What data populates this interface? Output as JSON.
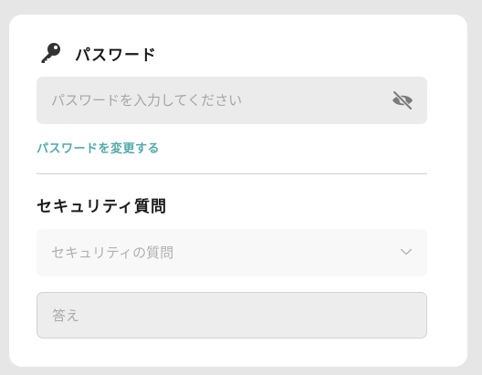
{
  "password_section": {
    "icon": "key-icon",
    "title": "パスワード",
    "input_placeholder": "パスワードを入力してください",
    "input_value": "",
    "visibility_icon": "eye-off-icon",
    "change_link": "パスワードを変更する"
  },
  "security_section": {
    "title": "セキュリティ質問",
    "select_placeholder": "セキュリティの質問",
    "select_icon": "chevron-down-icon",
    "answer_placeholder": "答え",
    "answer_value": ""
  },
  "colors": {
    "accent": "#52a9a9",
    "background": "#e6e6e6",
    "card": "#ffffff",
    "field": "#ebebeb"
  }
}
